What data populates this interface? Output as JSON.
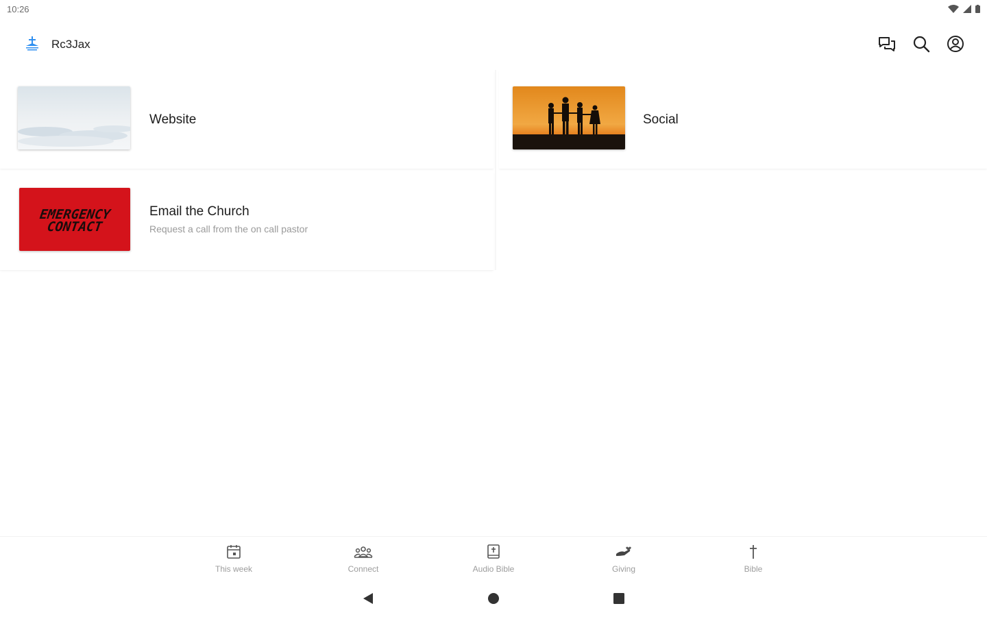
{
  "status": {
    "time": "10:26"
  },
  "app": {
    "title": "Rc3Jax",
    "brand_color": "#2f8ff0"
  },
  "actions": [
    {
      "name": "chat-icon"
    },
    {
      "name": "search-icon"
    },
    {
      "name": "account-icon"
    }
  ],
  "cards": {
    "website": {
      "title": "Website"
    },
    "social": {
      "title": "Social"
    },
    "email": {
      "title": "Email the Church",
      "subtitle": "Request a call from the on call pastor",
      "image_text_line1": "EMERGENCY",
      "image_text_line2": "CONTACT",
      "image_color": "#d4131b"
    }
  },
  "bottom_nav": {
    "this_week": "This week",
    "connect": "Connect",
    "audio_bible": "Audio Bible",
    "giving": "Giving",
    "bible": "Bible"
  }
}
